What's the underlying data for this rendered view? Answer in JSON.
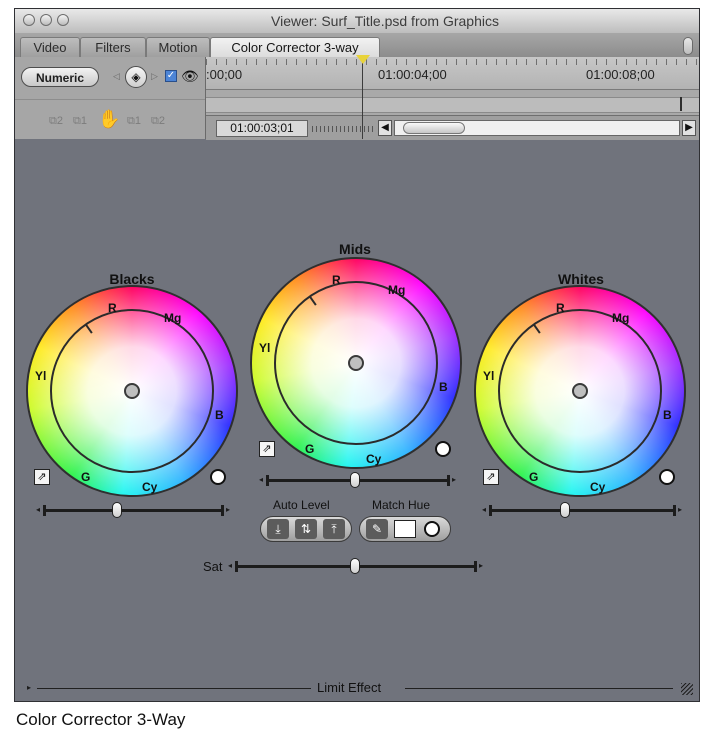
{
  "window": {
    "title": "Viewer: Surf_Title.psd from Graphics"
  },
  "tabs": [
    {
      "label": "Video"
    },
    {
      "label": "Filters"
    },
    {
      "label": "Motion"
    },
    {
      "label": "Color Corrector 3-way"
    }
  ],
  "controls": {
    "numeric_label": "Numeric",
    "keyframe_icon": "keyframe-diamond",
    "visibility_checked": true
  },
  "timeline": {
    "tick_labels": [
      ":00;00",
      "01:00:04;00",
      "01:00:08;00"
    ],
    "current_timecode": "01:00:03;01"
  },
  "wheels": {
    "blacks": {
      "label": "Blacks"
    },
    "mids": {
      "label": "Mids"
    },
    "whites": {
      "label": "Whites"
    },
    "hue_labels": {
      "r": "R",
      "mg": "Mg",
      "b": "B",
      "cy": "Cy",
      "g": "G",
      "yl": "Yl"
    }
  },
  "auto_level": {
    "label": "Auto Level"
  },
  "match_hue": {
    "label": "Match Hue"
  },
  "saturation": {
    "label": "Sat"
  },
  "limit_effect": {
    "label": "Limit Effect"
  },
  "caption": "Color Corrector 3-Way",
  "colors": {
    "panel_bg": "#70737c",
    "accent_checkbox": "#4c84d6",
    "playhead_marker": "#e8d33a"
  }
}
